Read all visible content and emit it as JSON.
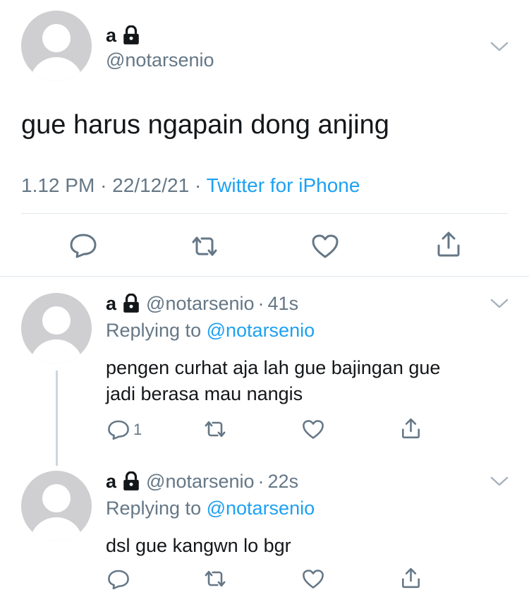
{
  "main_tweet": {
    "display_name": "a",
    "handle": "@notarsenio",
    "text": "gue harus ngapain dong anjing",
    "time": "1.12 PM",
    "sep1": "·",
    "date": "22/12/21",
    "sep2": "·",
    "source": "Twitter for iPhone"
  },
  "replies": [
    {
      "display_name": "a",
      "handle": "@notarsenio",
      "dot": "·",
      "age": "41s",
      "replying_label": "Replying to",
      "replying_to": "@notarsenio",
      "text_line1": "pengen curhat aja lah gue bajingan gue",
      "text_line2": "jadi berasa mau nangis",
      "reply_count": "1"
    },
    {
      "display_name": "a",
      "handle": "@notarsenio",
      "dot": "·",
      "age": "22s",
      "replying_label": "Replying to",
      "replying_to": "@notarsenio",
      "text_line1": "dsl gue kangwn lo bgr",
      "reply_count": ""
    }
  ],
  "icons": [
    "lock-icon",
    "chevron-down-icon",
    "reply-icon",
    "retweet-icon",
    "like-icon",
    "share-icon"
  ],
  "colors": {
    "link": "#1da1f2",
    "secondary": "#657786",
    "avatar": "#cfcfd2"
  }
}
